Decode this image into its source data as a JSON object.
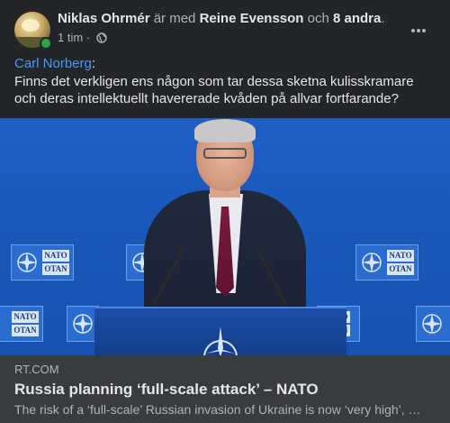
{
  "post": {
    "author": "Niklas Ohrmér",
    "with_text": "är med",
    "tagged": "Reine Evensson",
    "and_text": "och",
    "others": "8 andra",
    "period": ".",
    "time": "1 tim",
    "separator": "·",
    "audience_icon": "globe-icon",
    "more_icon": "ellipsis-icon"
  },
  "message": {
    "mention": "Carl Norberg",
    "colon": ":",
    "text": "Finns det verkligen ens någon som tar dessa sketna kulisskramare och deras intellektuellt havererade kvåden på allvar fortfarande?"
  },
  "photo": {
    "logo_line1": "NATO",
    "logo_line2": "OTAN"
  },
  "link": {
    "domain": "RT.COM",
    "title": "Russia planning ‘full-scale attack’ – NATO",
    "description": "The risk of a ‘full-scale’ Russian invasion of Ukraine is now ‘very high’, NATO chief Jens Stoltenberg says"
  },
  "colors": {
    "background": "#242526",
    "link_blue": "#4599ff",
    "online_green": "#31a24c",
    "photo_blue": "#1a58bb"
  }
}
